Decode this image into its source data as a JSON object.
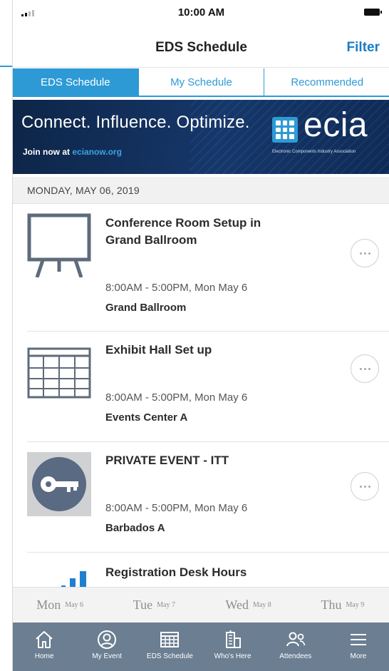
{
  "status_bar": {
    "time": "10:00 AM"
  },
  "nav": {
    "title": "EDS Schedule",
    "filter_label": "Filter"
  },
  "tabs": [
    {
      "label": "EDS Schedule",
      "active": true
    },
    {
      "label": "My Schedule",
      "active": false
    },
    {
      "label": "Recommended",
      "active": false
    }
  ],
  "banner": {
    "headline": "Connect. Influence. Optimize.",
    "join_prefix": "Join now at ",
    "join_url": "ecianow.org",
    "brand": "ecia",
    "brand_subtitle": "Electronic Components Industry Association"
  },
  "date_header": "MONDAY, MAY 06, 2019",
  "events": [
    {
      "title": "Conference Room Setup in Grand Ballroom",
      "time": "8:00AM - 5:00PM, Mon May 6",
      "location": "Grand Ballroom",
      "icon": "easel-icon"
    },
    {
      "title": "Exhibit Hall Set up",
      "time": "8:00AM - 5:00PM, Mon May 6",
      "location": "Events Center A",
      "icon": "calendar-grid-icon"
    },
    {
      "title": "PRIVATE EVENT - ITT",
      "time": "8:00AM - 5:00PM, Mon May 6",
      "location": "Barbados A",
      "icon": "key-icon"
    },
    {
      "title": "Registration Desk Hours",
      "time": "",
      "location": "",
      "icon": "bar-chart-icon"
    }
  ],
  "days": [
    {
      "name": "Mon",
      "date": "May 6"
    },
    {
      "name": "Tue",
      "date": "May 7"
    },
    {
      "name": "Wed",
      "date": "May 8"
    },
    {
      "name": "Thu",
      "date": "May 9"
    }
  ],
  "tabbar": [
    {
      "label": "Home",
      "icon": "home-icon"
    },
    {
      "label": "My Event",
      "icon": "person-circle-icon"
    },
    {
      "label": "EDS Schedule",
      "icon": "calendar-icon"
    },
    {
      "label": "Who's Here",
      "icon": "building-icon"
    },
    {
      "label": "Attendees",
      "icon": "people-icon"
    },
    {
      "label": "More",
      "icon": "menu-icon"
    }
  ],
  "colors": {
    "accent": "#2d9ad6",
    "link": "#1a7cc6",
    "tabbar_bg": "#6b7e92",
    "banner_bg": "#0d2547"
  }
}
